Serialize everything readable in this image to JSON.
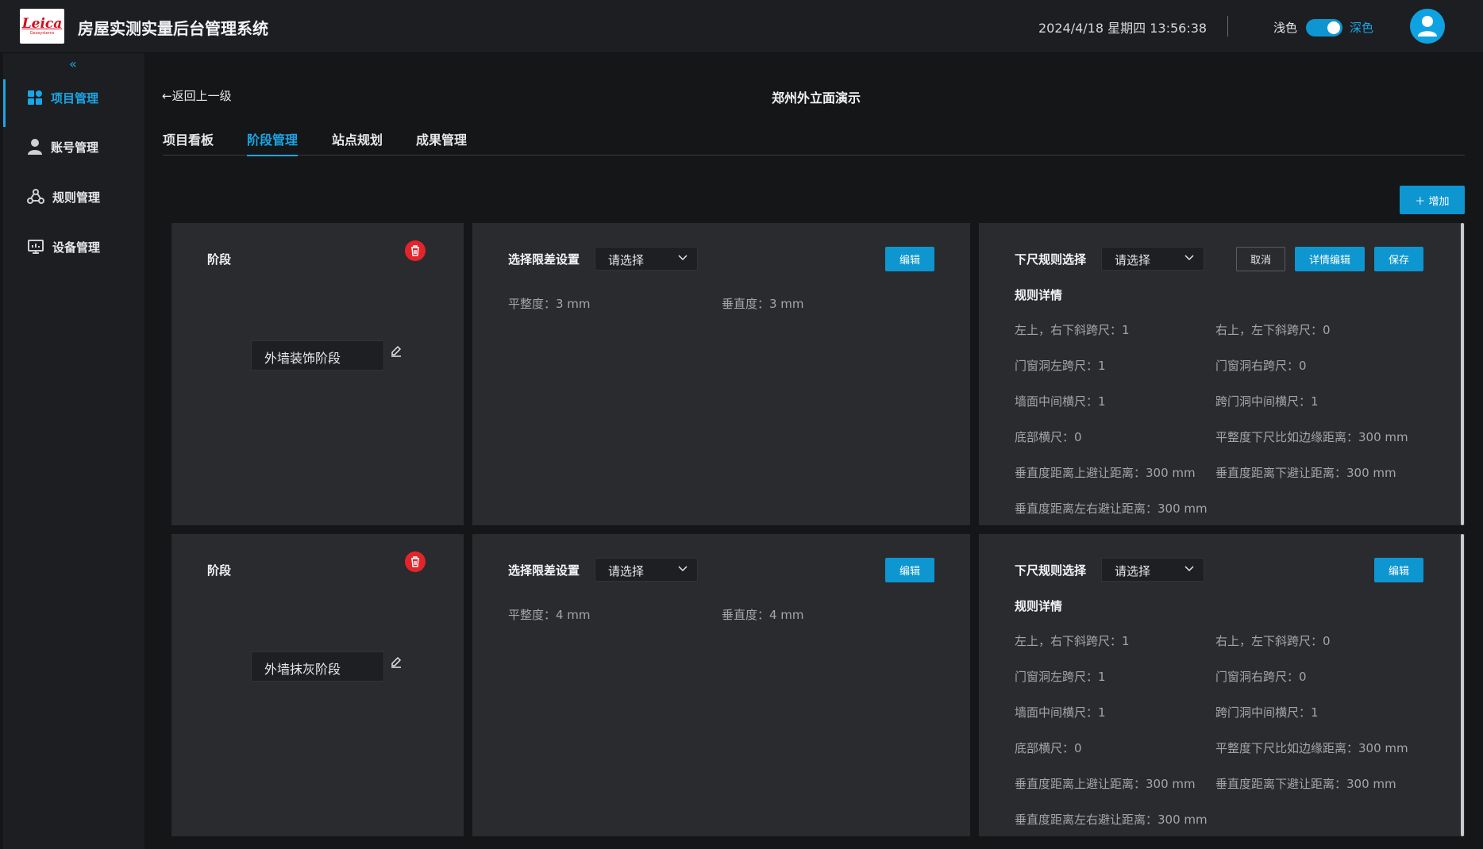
{
  "header": {
    "logo_text": "Leica",
    "logo_sub": "Geosystems",
    "app_title": "房屋实测实量后台管理系统",
    "datetime": "2024/4/18  星期四   13:56:38",
    "theme_light": "浅色",
    "theme_dark": "深色"
  },
  "sidebar": {
    "collapse_glyph": "«",
    "items": [
      {
        "label": "项目管理"
      },
      {
        "label": "账号管理"
      },
      {
        "label": "规则管理"
      },
      {
        "label": "设备管理"
      }
    ]
  },
  "main": {
    "back_label": "←返回上一级",
    "page_title": "郑州外立面演示",
    "tabs": [
      {
        "label": "项目看板"
      },
      {
        "label": "阶段管理"
      },
      {
        "label": "站点规划"
      },
      {
        "label": "成果管理"
      }
    ],
    "add_label": "＋ 增加"
  },
  "stages": [
    {
      "stage_label": "阶段",
      "stage_name": "外墙装饰阶段",
      "tolerance_label": "选择限差设置",
      "tolerance_select": "请选择",
      "flatness": "平整度：3 mm",
      "verticality": "垂直度：3 mm",
      "edit_label": "编辑",
      "rule_select_label": "下尺规则选择",
      "rule_select": "请选择",
      "cancel_label": "取消",
      "detail_edit_label": "详情编辑",
      "save_label": "保存",
      "rule_detail_title": "规则详情",
      "rules": [
        "左上，右下斜跨尺：1",
        "右上，左下斜跨尺：0",
        "门窗洞左跨尺：1",
        "门窗洞右跨尺：0",
        "墙面中间横尺：1",
        "跨门洞中间横尺：1",
        "底部横尺：0",
        "平整度下尺比如边缘距离：300 mm",
        "垂直度距离上避让距离：300 mm",
        "垂直度距离下避让距离：300 mm",
        "垂直度距离左右避让距离：300 mm"
      ]
    },
    {
      "stage_label": "阶段",
      "stage_name": "外墙抹灰阶段",
      "tolerance_label": "选择限差设置",
      "tolerance_select": "请选择",
      "flatness": "平整度：4 mm",
      "verticality": "垂直度：4 mm",
      "edit_label": "编辑",
      "rule_select_label": "下尺规则选择",
      "rule_select": "请选择",
      "rule_edit_label": "编辑",
      "rule_detail_title": "规则详情",
      "rules": [
        "左上，右下斜跨尺：1",
        "右上，左下斜跨尺：0",
        "门窗洞左跨尺：1",
        "门窗洞右跨尺：0",
        "墙面中间横尺：1",
        "跨门洞中间横尺：1",
        "底部横尺：0",
        "平整度下尺比如边缘距离：300 mm",
        "垂直度距离上避让距离：300 mm",
        "垂直度距离下避让距离：300 mm",
        "垂直度距离左右避让距离：300 mm"
      ]
    }
  ],
  "colors": {
    "accent": "#0d96cf",
    "danger": "#e3242b",
    "card": "#2a2b2e",
    "background": "#151618"
  }
}
